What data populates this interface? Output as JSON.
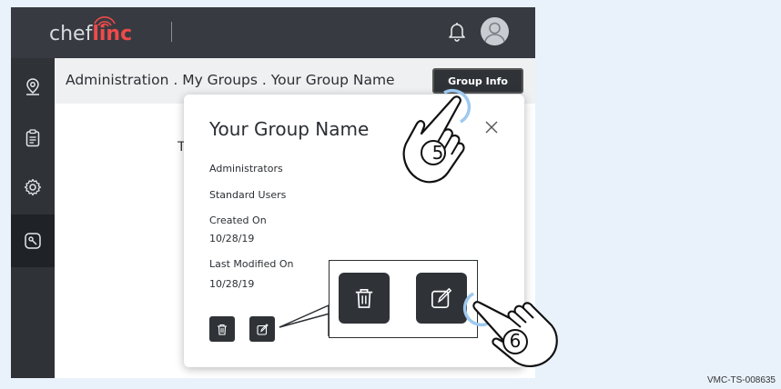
{
  "topbar": {
    "logo_prefix": "chef",
    "logo_suffix": "linc",
    "bell_icon": "bell-icon",
    "avatar_icon": "user-avatar-icon"
  },
  "sidebar": {
    "items": [
      {
        "icon": "map-pin-icon"
      },
      {
        "icon": "clipboard-icon"
      },
      {
        "icon": "gear-icon"
      },
      {
        "icon": "tag-icon",
        "active": true
      }
    ]
  },
  "breadcrumb": {
    "text": "Administration . My Groups . Your Group Name",
    "group_info_label": "Group Info"
  },
  "background": {
    "partial_text": "T"
  },
  "modal": {
    "title": "Your Group Name",
    "administrators_label": "Administrators",
    "standard_users_label": "Standard Users",
    "created_on_label": "Created On",
    "created_on_value": "10/28/19",
    "last_modified_label": "Last Modified On",
    "last_modified_value": "10/28/19"
  },
  "annotations": {
    "step_five": "5",
    "step_six": "6",
    "reference": "VMC-TS-008635"
  },
  "colors": {
    "dark": "#2f3338",
    "topbar": "#373b41",
    "brand_red": "#ef4a4a",
    "highlight_ring": "#9ec9ef",
    "page_bg": "#e9f2fb"
  }
}
